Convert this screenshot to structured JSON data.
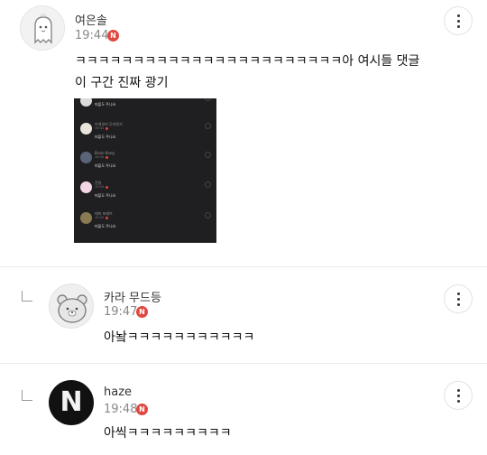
{
  "comments": [
    {
      "author": "여은솔",
      "time": "19:44",
      "badge": "N",
      "text_lines": [
        "ㅋㅋㅋㅋㅋㅋㅋㅋㅋㅋㅋㅋㅋㅋㅋㅋㅋㅋㅋㅋㅋㅋㅋ아 여시들 댓글",
        "이 구간 진짜 광기"
      ],
      "attached_image": {
        "rows": [
          {
            "name": "",
            "time": "",
            "text": "퍼플도 주나요",
            "avatar_color": "#dcdcdc"
          },
          {
            "name": "뜨개부터 무리한거",
            "time": "19:44",
            "text": "퍼플도 주나요",
            "avatar_color": "#e8e4dc"
          },
          {
            "name": "Brain Kang",
            "time": "19:44",
            "text": "퍼플도 주나요",
            "avatar_color": "#5a6478"
          },
          {
            "name": "전일",
            "time": "19:44",
            "text": "퍼플도 주나요",
            "avatar_color": "#f3d6e6"
          },
          {
            "name": "태미 포레브",
            "time": "19:44",
            "text": "퍼플도 주나요",
            "avatar_color": "#8a7a52"
          }
        ]
      }
    },
    {
      "author": "카라 무드등",
      "time": "19:47",
      "badge": "N",
      "text_lines": [
        "아놬ㅋㅋㅋㅋㅋㅋㅋㅋㅋㅋㅋ"
      ]
    },
    {
      "author": "haze",
      "time": "19:48",
      "badge": "N",
      "avatar_letter": "N",
      "text_lines": [
        "아씩ㅋㅋㅋㅋㅋㅋㅋㅋㅋ"
      ]
    }
  ],
  "colors": {
    "badge": "#e0473f",
    "divider": "#ececec",
    "image_bg": "#1f1f21"
  },
  "icons": {
    "more": "more-vertical-icon",
    "reply": "reply-arrow-icon",
    "badge": "new-badge-icon"
  }
}
